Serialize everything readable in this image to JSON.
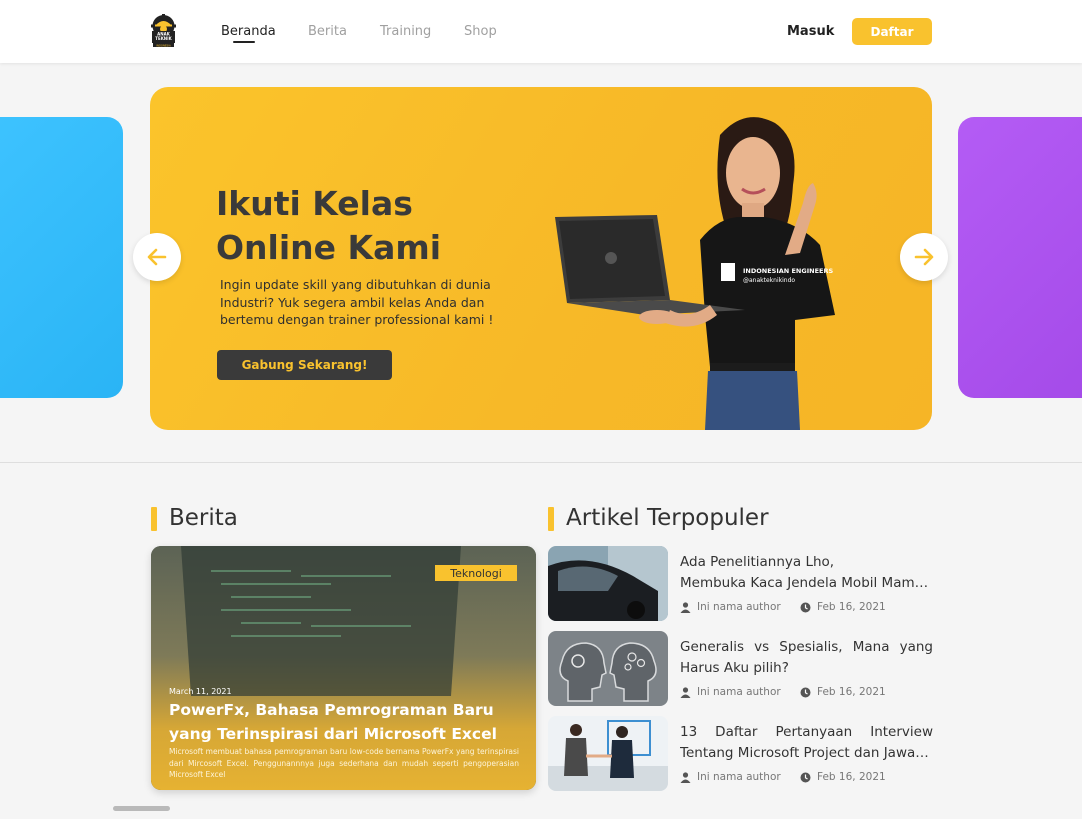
{
  "header": {
    "logo_text": "ANAK TEKNIK INDONESIA",
    "nav": [
      {
        "label": "Beranda",
        "active": true
      },
      {
        "label": "Berita",
        "active": false
      },
      {
        "label": "Training",
        "active": false
      },
      {
        "label": "Shop",
        "active": false
      }
    ],
    "login_label": "Masuk",
    "register_label": "Daftar"
  },
  "banner": {
    "title_line1": "Ikuti Kelas",
    "title_line2": "Online Kami",
    "subtitle": "Ingin update skill yang dibutuhkan di dunia Industri? Yuk segera ambil kelas Anda dan bertemu dengan trainer professional kami !",
    "cta_label": "Gabung Sekarang!",
    "shirt_text": "INDONESIAN ENGINEERS @anakteknikindo"
  },
  "news_section": {
    "heading": "Berita",
    "card": {
      "tag": "Teknologi",
      "date": "March 11, 2021",
      "title": "PowerFx, Bahasa Pemrograman Baru yang Terinspirasi dari Microsoft Excel",
      "description": "Microsoft membuat bahasa pemrograman baru low-code bernama PowerFx yang terinspirasi dari Mircosoft Excel. Penggunannnya juga sederhana dan mudah seperti pengoperasian Microsoft Excel"
    }
  },
  "popular_section": {
    "heading": "Artikel Terpopuler",
    "articles": [
      {
        "title_line1": "Ada Penelitiannya Lho,",
        "title_line2": "Membuka Kaca Jendela Mobil Mamp...",
        "author": "Ini nama author",
        "date": "Feb 16, 2021"
      },
      {
        "title_line1": "Generalis vs Spesialis, Mana yang",
        "title_line2": "Harus Aku pilih?",
        "author": "Ini nama author",
        "date": "Feb 16, 2021"
      },
      {
        "title_line1": "13 Daftar Pertanyaan Interview",
        "title_line2": "Tentang Microsoft Project dan Jawab...",
        "author": "Ini nama author",
        "date": "Feb 16, 2021"
      }
    ]
  },
  "colors": {
    "accent": "#f9c22e",
    "dark": "#3a3a3a",
    "side_left": "#3ec3ff",
    "side_right": "#b45cf5"
  },
  "icons": [
    "arrow-left-icon",
    "arrow-right-icon",
    "user-icon",
    "clock-icon"
  ]
}
